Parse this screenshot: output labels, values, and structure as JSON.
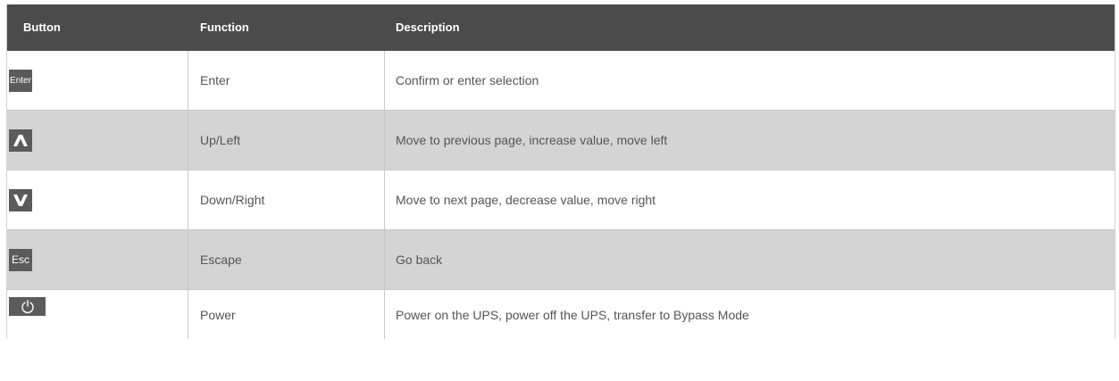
{
  "table": {
    "headers": {
      "button": "Button",
      "function": "Function",
      "description": "Description"
    },
    "rows": [
      {
        "key_label": "Enter",
        "key_icon": "enter-key",
        "function": "Enter",
        "description": "Confirm or enter selection",
        "shaded": false
      },
      {
        "key_label": "",
        "key_icon": "up-arrow-icon",
        "function": "Up/Left",
        "description": "Move to previous page, increase value, move left",
        "shaded": true
      },
      {
        "key_label": "",
        "key_icon": "down-arrow-icon",
        "function": "Down/Right",
        "description": "Move to next page, decrease value, move right",
        "shaded": false
      },
      {
        "key_label": "Esc",
        "key_icon": "esc-key",
        "function": "Escape",
        "description": "Go back",
        "shaded": true
      },
      {
        "key_label": "",
        "key_icon": "power-icon",
        "function": "Power",
        "description": "Power on the UPS, power off the UPS, transfer to Bypass Mode",
        "shaded": false
      }
    ]
  },
  "colors": {
    "header_bg": "#4b4b4b",
    "shaded_row_bg": "#d4d4d4",
    "key_bg": "#5b5b5b"
  }
}
